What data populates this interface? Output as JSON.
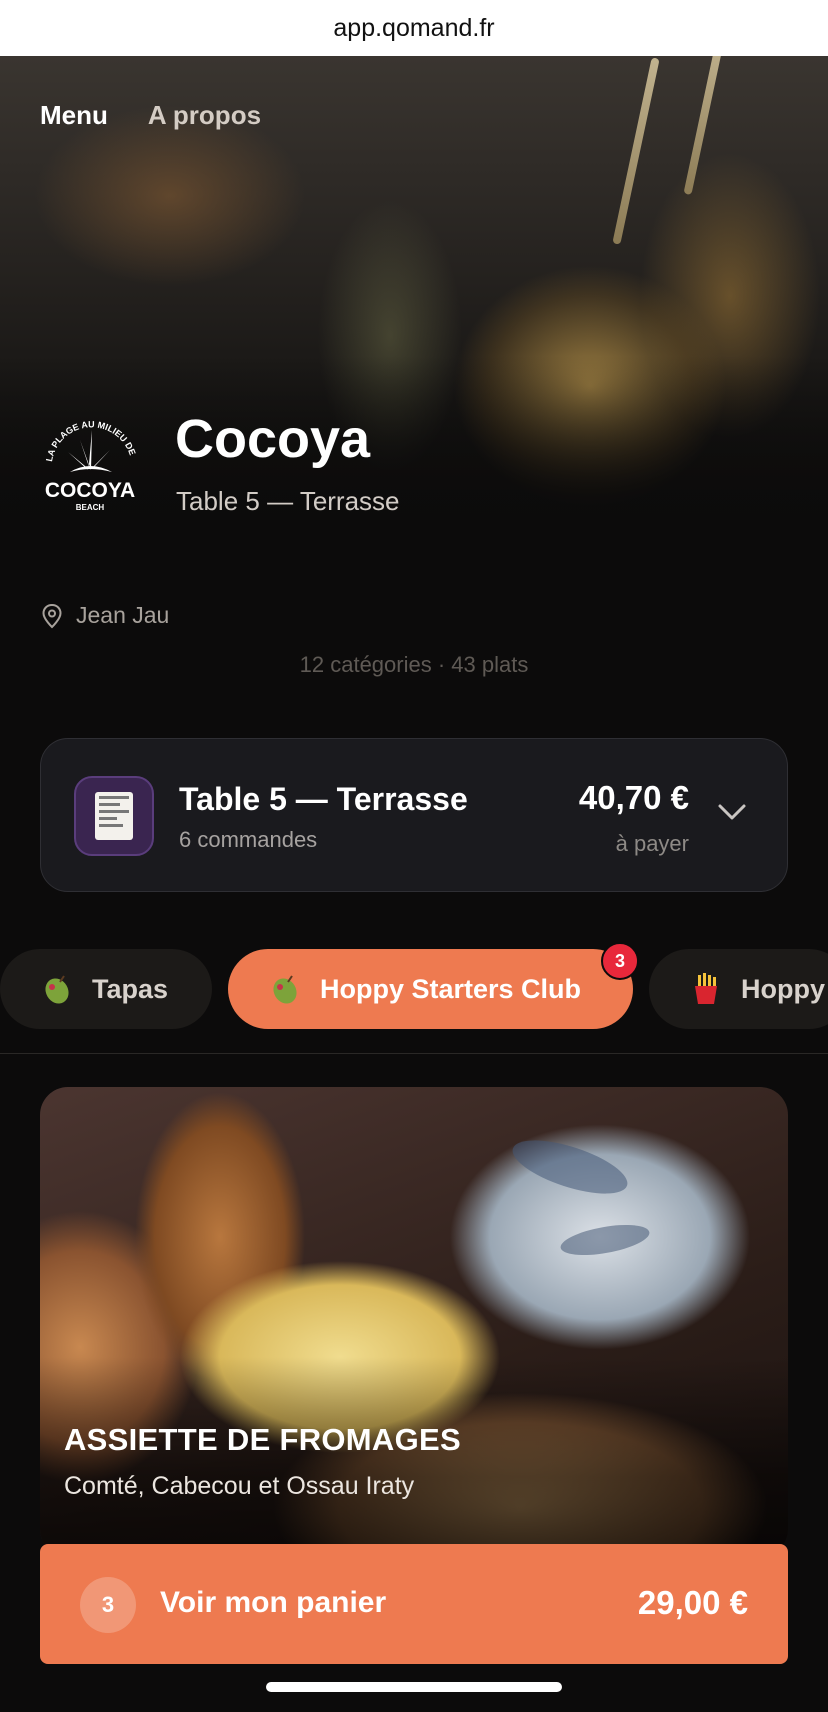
{
  "browser": {
    "url": "app.qomand.fr"
  },
  "nav": {
    "menu_label": "Menu",
    "about_label": "A propos"
  },
  "restaurant": {
    "name": "Cocoya",
    "table": "Table 5 — Terrasse",
    "location": "Jean Jau",
    "counts": "12 catégories · 43 plats",
    "logo_text": {
      "top": "LA PLAGE AU MILIEU DES VIGNES",
      "name": "COCOYA",
      "sub": "BEACH"
    }
  },
  "order_summary": {
    "title": "Table 5 — Terrasse",
    "subtitle": "6 commandes",
    "amount": "40,70 €",
    "amount_label": "à payer",
    "icon": "receipt-icon"
  },
  "categories": [
    {
      "label": "Tapas",
      "icon": "olive-icon",
      "active": false
    },
    {
      "label": "Hoppy Starters Club",
      "icon": "olive-icon",
      "active": true,
      "badge": "3"
    },
    {
      "label": "Hoppy",
      "icon": "fries-icon",
      "active": false
    }
  ],
  "featured_dish": {
    "title": "ASSIETTE DE FROMAGES",
    "description": "Comté, Cabecou et Ossau Iraty"
  },
  "cart": {
    "count": "3",
    "label": "Voir mon panier",
    "total": "29,00 €"
  },
  "colors": {
    "accent": "#ee7a50",
    "badge": "#e8283b",
    "background": "#0c0b0b",
    "card": "#1a1a1e"
  }
}
